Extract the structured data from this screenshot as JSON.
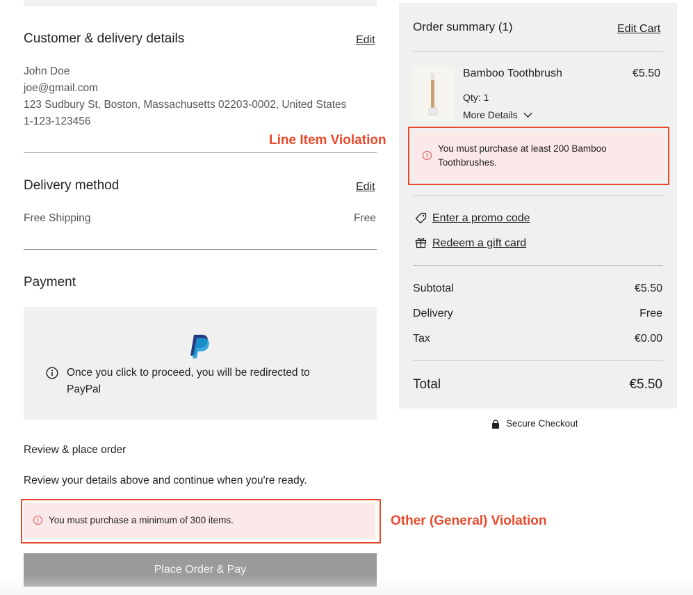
{
  "customer": {
    "title": "Customer & delivery details",
    "edit_label": "Edit",
    "name": "John Doe",
    "email": "joe@gmail.com",
    "address": "123 Sudbury St, Boston, Massachusetts 02203-0002, United States",
    "phone": "1-123-123456"
  },
  "delivery": {
    "title": "Delivery method",
    "edit_label": "Edit",
    "method": "Free Shipping",
    "price": "Free"
  },
  "payment": {
    "title": "Payment",
    "notice": "Once you click to proceed, you will be redirected to PayPal"
  },
  "review": {
    "title": "Review & place order",
    "description": "Review your details above and continue when you're ready.",
    "violation": "You must purchase a minimum of 300 items.",
    "button_label": "Place Order & Pay"
  },
  "annotations": {
    "line_item": "Line Item Violation",
    "general": "Other (General) Violation"
  },
  "summary": {
    "title": "Order summary",
    "count": "(1)",
    "edit_cart_label": "Edit Cart",
    "item": {
      "name": "Bamboo Toothbrush",
      "price": "€5.50",
      "qty": "Qty: 1",
      "more_details": "More Details"
    },
    "item_violation": "You must purchase at least 200 Bamboo Toothbrushes.",
    "promo_label": "Enter a promo code",
    "gift_label": "Redeem a gift card",
    "subtotal_label": "Subtotal",
    "subtotal_value": "€5.50",
    "delivery_label": "Delivery",
    "delivery_value": "Free",
    "tax_label": "Tax",
    "tax_value": "€0.00",
    "total_label": "Total",
    "total_value": "€5.50"
  },
  "secure_checkout": "Secure Checkout",
  "colors": {
    "violation_frame": "#e8492b",
    "violation_bg": "#fbe8e8",
    "paypal_dark": "#253b80",
    "paypal_light": "#179bd7"
  }
}
